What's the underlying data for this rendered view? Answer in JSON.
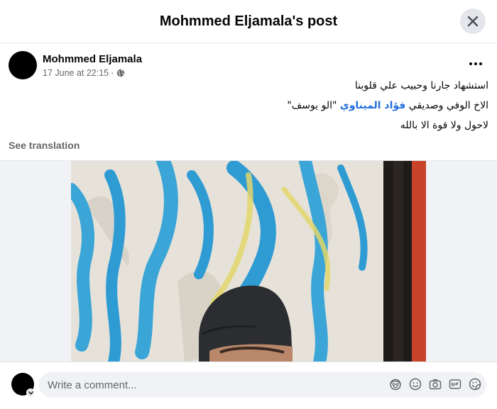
{
  "dialog": {
    "title": "Mohmmed Eljamala's post"
  },
  "post": {
    "author": "Mohmmed Eljamala",
    "timestamp": "17 June at 22:15",
    "separator": "·",
    "audience_icon": "globe-icon",
    "text_line1": "استشهاد جارنا وحبيب علي قلوبنا",
    "text_line2_before": "الاخ الوفي وصديقي ",
    "text_line2_mention": "فؤاد الميناوي",
    "text_line2_after": " \"الو يوسف\"",
    "text_line3": "لاحول ولا قوة الا بالله",
    "see_translation": "See translation"
  },
  "comment": {
    "placeholder": "Write a comment...",
    "tools": [
      "avatar-sticker-icon",
      "emoji-icon",
      "camera-icon",
      "gif-icon",
      "sticker-icon"
    ]
  },
  "colors": {
    "mention": "#216fdb",
    "secondary_text": "#65676b",
    "input_bg": "#f0f2f5",
    "close_bg": "#e4e6eb"
  }
}
